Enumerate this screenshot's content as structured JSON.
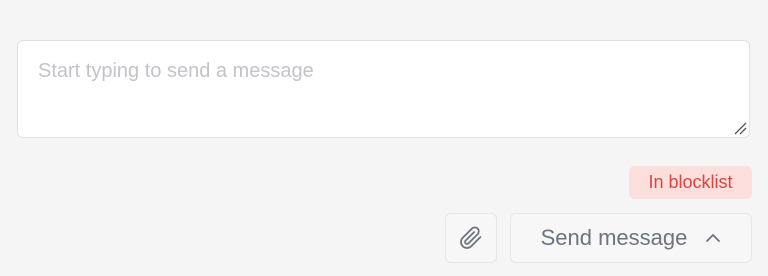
{
  "composer": {
    "placeholder": "Start typing to send a message",
    "value": ""
  },
  "status_badge": {
    "label": "In blocklist",
    "background": "#fcdedd",
    "text_color": "#d9473f"
  },
  "actions": {
    "attach_icon": "paperclip-icon",
    "send_label": "Send message",
    "send_menu_icon": "chevron-up-icon"
  }
}
